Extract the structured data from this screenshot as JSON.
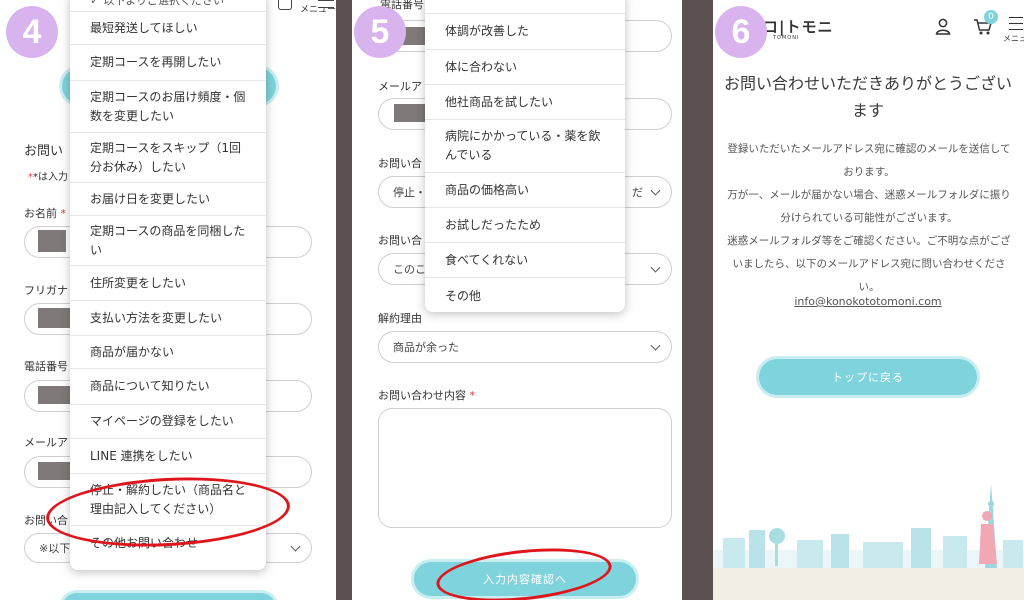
{
  "panel4": {
    "step": "4",
    "dropdown_top": "以下よりご選択ください",
    "options": [
      "最短発送してほしい",
      "定期コースを再開したい",
      "定期コースのお届け頻度・個数を変更したい",
      "定期コースをスキップ（1回分お休み）したい",
      "お届け日を変更したい",
      "定期コースの商品を同梱したい",
      "住所変更をしたい",
      "支払い方法を変更したい",
      "商品が届かない",
      "商品について知りたい",
      "マイページの登録をしたい",
      "LINE 連携をしたい",
      "停止・解約したい（商品名と理由記入してください）",
      "その他お問い合わせ"
    ],
    "section_title": "お問い",
    "required_note": "*は入力",
    "fields": [
      {
        "label": "お名前",
        "required": "*"
      },
      {
        "label": "フリガナ",
        "required": ""
      },
      {
        "label": "電話番号",
        "required": ""
      },
      {
        "label": "メールア",
        "required": ""
      },
      {
        "label": "お問い合",
        "required": ""
      }
    ],
    "select_value": "※以下"
  },
  "panel5": {
    "step": "5",
    "labels": {
      "phone": "電話番号",
      "mail": "メールア",
      "inquiry1": "お問い合",
      "inquiry2": "お問い合",
      "reason": "解約理由",
      "content": "お問い合わせ内容",
      "content_required": "*"
    },
    "select1_left": "停止・",
    "select1_right": "だ",
    "select2_left": "このこ",
    "reason_value": "商品が余った",
    "options": [
      "体調が改善した",
      "体に合わない",
      "他社商品を試したい",
      "病院にかかっている・薬を飲んでいる",
      "商品の価格高い",
      "お試しだったため",
      "食べてくれない",
      "その他"
    ],
    "confirm_button": "入力内容確認へ"
  },
  "panel6": {
    "step": "6",
    "logo": "コ|トモニ",
    "logo_sub": "TOMONI",
    "menu_label": "メニュ",
    "cart_count": "0",
    "heading": "お問い合わせいただきありがとうございます",
    "message": "登録いただいたメールアドレス宛に確認のメールを送信しております。\n万が一、メールが届かない場合、迷惑メールフォルダに振り分けられている可能性がございます。\n迷惑メールフォルダ等をご確認ください。ご不明な点がございましたら、以下のメールアドレス宛に問い合わせください。",
    "email": "info@konokototomoni.com",
    "top_button": "トップに戻る"
  },
  "colors": {
    "teal": "#7fd3dc",
    "step_badge": "#d9b3ee",
    "highlight": "#e0151b",
    "divider": "#5a5150"
  },
  "icons": [
    "user-icon",
    "cart-icon",
    "menu-icon",
    "chevron-down-icon"
  ]
}
